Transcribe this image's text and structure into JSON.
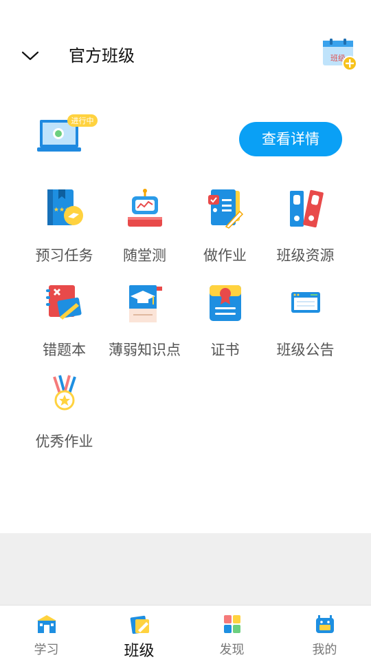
{
  "header": {
    "title": "官方班级",
    "add_class_icon_text": "班级"
  },
  "banner": {
    "badge": "进行中",
    "detail_button": "查看详情"
  },
  "features": [
    {
      "label": "预习任务",
      "icon": "preview-task-icon"
    },
    {
      "label": "随堂测",
      "icon": "class-test-icon"
    },
    {
      "label": "做作业",
      "icon": "homework-icon"
    },
    {
      "label": "班级资源",
      "icon": "class-resources-icon"
    },
    {
      "label": "错题本",
      "icon": "mistake-book-icon"
    },
    {
      "label": "薄弱知识点",
      "icon": "weak-points-icon"
    },
    {
      "label": "证书",
      "icon": "certificate-icon"
    },
    {
      "label": "班级公告",
      "icon": "announcement-icon"
    },
    {
      "label": "优秀作业",
      "icon": "excellent-work-icon"
    }
  ],
  "tabs": [
    {
      "label": "学习",
      "icon": "study-icon",
      "active": false
    },
    {
      "label": "班级",
      "icon": "class-icon",
      "active": true
    },
    {
      "label": "发现",
      "icon": "discover-icon",
      "active": false
    },
    {
      "label": "我的",
      "icon": "profile-icon",
      "active": false
    }
  ],
  "colors": {
    "accent": "#0aa0f5",
    "band_gray": "#efefef",
    "label_gray": "#555555"
  }
}
